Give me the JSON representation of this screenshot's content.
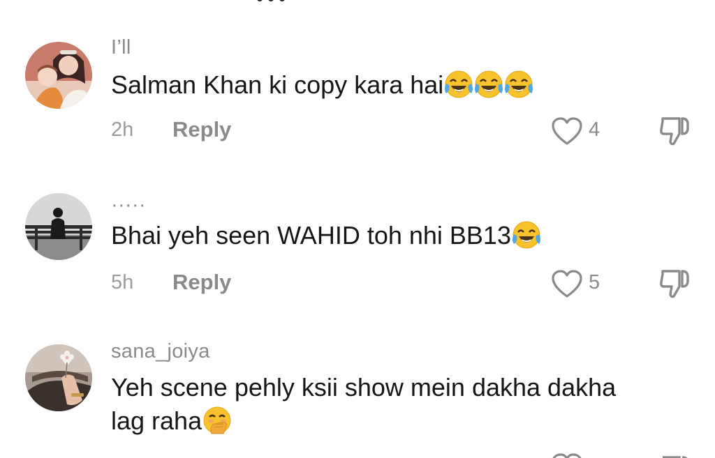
{
  "comments": [
    {
      "username": "I’ll",
      "text": "Salman Khan ki copy kara hai",
      "emojis": [
        "face-with-tears-of-joy",
        "face-with-tears-of-joy",
        "face-with-tears-of-joy"
      ],
      "time": "2h",
      "reply_label": "Reply",
      "likes": "4"
    },
    {
      "username": "·····",
      "text": "Bhai yeh seen WAHID toh nhi BB13",
      "emojis": [
        "face-with-tears-of-joy"
      ],
      "time": "5h",
      "reply_label": "Reply",
      "likes": "5"
    },
    {
      "username": "sana_joiya",
      "text_line1": "Yeh scene pehly ksii show mein dakha dakha",
      "text_line2": "lag raha",
      "emojis": [
        "face-with-hand-over-mouth"
      ]
    }
  ],
  "icons": {
    "like": "heart-outline-icon",
    "dislike": "thumbs-down-outline-icon"
  },
  "colors": {
    "text": "#161616",
    "secondary": "#8a8a8a",
    "emoji_yellow": "#f7c22b",
    "tears_blue": "#4ea7e6"
  }
}
